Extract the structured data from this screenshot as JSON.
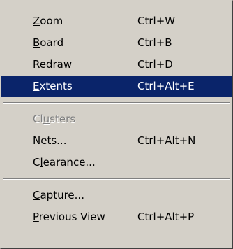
{
  "menu": {
    "items": [
      {
        "pre": "",
        "mn": "Z",
        "post": "oom",
        "shortcut": "Ctrl+W"
      },
      {
        "pre": "",
        "mn": "B",
        "post": "oard",
        "shortcut": "Ctrl+B"
      },
      {
        "pre": "",
        "mn": "R",
        "post": "edraw",
        "shortcut": "Ctrl+D"
      },
      {
        "pre": "",
        "mn": "E",
        "post": "xtents",
        "shortcut": "Ctrl+Alt+E"
      },
      {
        "pre": "Cl",
        "mn": "u",
        "post": "sters",
        "shortcut": ""
      },
      {
        "pre": "",
        "mn": "N",
        "post": "ets...",
        "shortcut": "Ctrl+Alt+N"
      },
      {
        "pre": "C",
        "mn": "l",
        "post": "earance...",
        "shortcut": ""
      },
      {
        "pre": "",
        "mn": "C",
        "post": "apture...",
        "shortcut": ""
      },
      {
        "pre": "",
        "mn": "P",
        "post": "revious View",
        "shortcut": "Ctrl+Alt+P"
      }
    ]
  },
  "colors": {
    "menu_background": "#d4d0c8",
    "highlight_background": "#0a246a",
    "highlight_text": "#ffffff",
    "disabled_text": "#808080"
  }
}
